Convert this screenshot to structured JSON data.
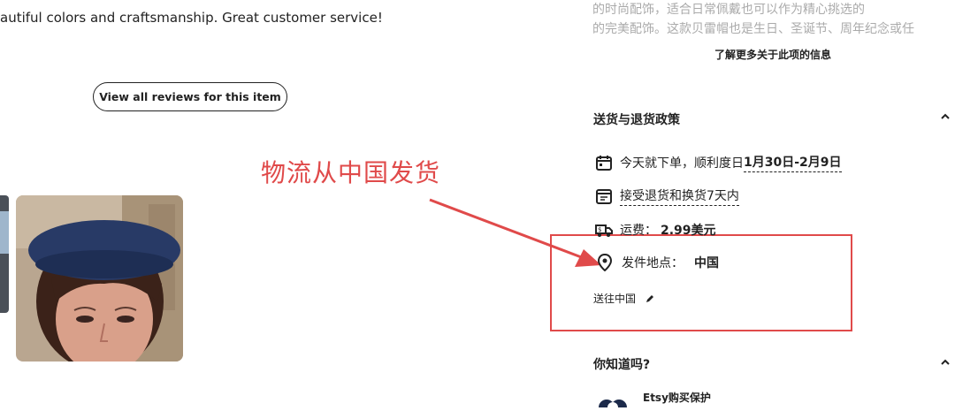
{
  "review": {
    "text_fragment": "autiful colors and craftsmanship. Great customer service!",
    "view_all_button": "View all reviews for this item"
  },
  "description": {
    "faded_line_1": "的时尚配饰，适合日常佩戴也可以作为精心挑选的",
    "faded_line_2": "的完美配饰。这款贝雷帽也是生日、圣诞节、周年纪念或任",
    "learn_more_link": "了解更多关于此项的信息"
  },
  "shipping": {
    "title": "送货与退货政策",
    "delivery_prefix": "今天就下单，顺利度日",
    "delivery_dates": "1月30日-2月9日",
    "returns": "接受退货和换货7天内",
    "shipping_fee_label": "运费：",
    "shipping_fee_value": "2.99美元",
    "ship_from_label": "发件地点：",
    "ship_from_value": "中国",
    "ship_to": "送往中国"
  },
  "did_you_know": {
    "title": "你知道吗?",
    "etsy_protection": "Etsy购买保护"
  },
  "annotation": {
    "text": "物流从中国发货",
    "color": "#e04a4a"
  },
  "icons": [
    "calendar-icon",
    "returns-icon",
    "truck-icon",
    "location-pin-icon",
    "pencil-icon",
    "chevron-up-icon"
  ]
}
